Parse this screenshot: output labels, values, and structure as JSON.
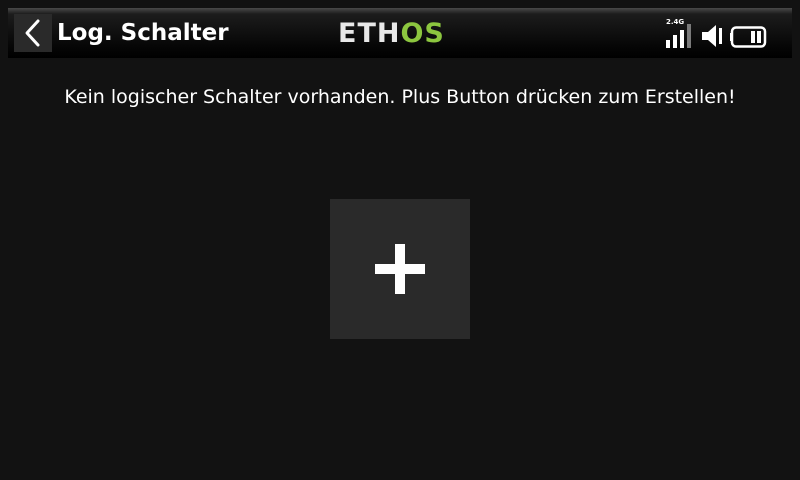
{
  "header": {
    "title": "Log. Schalter",
    "logo_left": "ETH",
    "logo_right": "OS",
    "back_icon": "chevron-left-icon",
    "status": {
      "rf_band": "2.4G",
      "signal_icon": "signal-bars-icon",
      "volume_icon": "speaker-icon",
      "battery_icon": "battery-icon"
    }
  },
  "main": {
    "empty_message": "Kein logischer Schalter vorhanden. Plus Button drücken zum Erstellen!",
    "add_icon": "plus-icon"
  },
  "colors": {
    "background": "#121212",
    "button_bg": "#2a2a2a",
    "logo_accent": "#8cc63f",
    "text": "#ffffff"
  }
}
